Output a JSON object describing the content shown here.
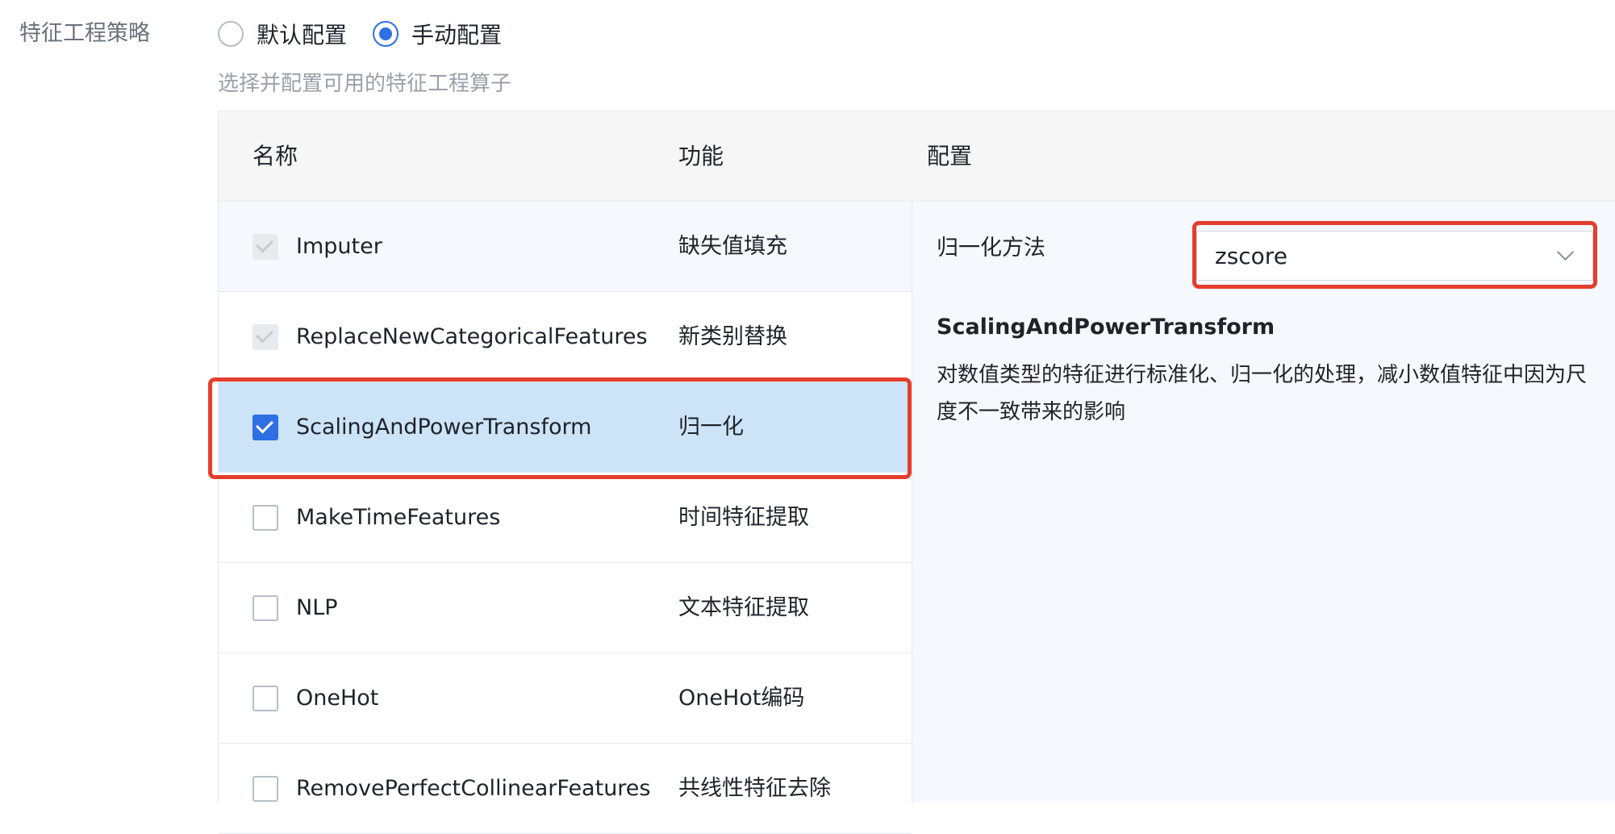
{
  "strategy": {
    "label": "特征工程策略",
    "options": [
      {
        "label": "默认配置",
        "checked": false
      },
      {
        "label": "手动配置",
        "checked": true
      }
    ],
    "hint": "选择并配置可用的特征工程算子"
  },
  "table": {
    "headers": {
      "name": "名称",
      "function": "功能",
      "config": "配置"
    },
    "rows": [
      {
        "name": "Imputer",
        "function": "缺失值填充",
        "state": "disabled-checked"
      },
      {
        "name": "ReplaceNewCategoricalFeatures",
        "function": "新类别替换",
        "state": "disabled-checked"
      },
      {
        "name": "ScalingAndPowerTransform",
        "function": "归一化",
        "state": "checked"
      },
      {
        "name": "MakeTimeFeatures",
        "function": "时间特征提取",
        "state": "unchecked"
      },
      {
        "name": "NLP",
        "function": "文本特征提取",
        "state": "unchecked"
      },
      {
        "name": "OneHot",
        "function": "OneHot编码",
        "state": "unchecked"
      },
      {
        "name": "RemovePerfectCollinearFeatures",
        "function": "共线性特征去除",
        "state": "unchecked"
      }
    ]
  },
  "config": {
    "method_label": "归一化方法",
    "method_value": "zscore",
    "desc_title": "ScalingAndPowerTransform",
    "desc_text": "对数值类型的特征进行标准化、归一化的处理，减小数值特征中因为尺度不一致带来的影响"
  },
  "colors": {
    "accent": "#2f6fe4",
    "selected_row": "#cce3f8",
    "highlight": "#e53d2e"
  }
}
